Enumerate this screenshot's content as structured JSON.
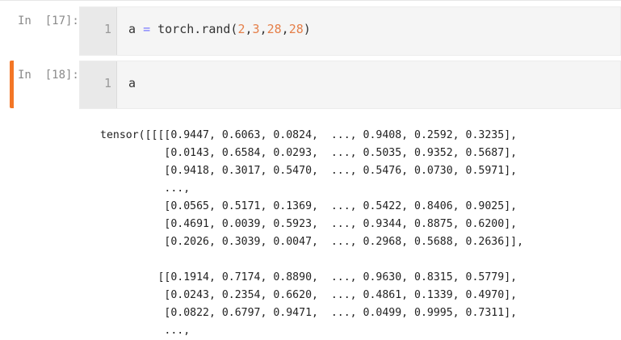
{
  "cells": [
    {
      "prompt": "In  [17]:",
      "line_number": "1",
      "code": {
        "var": "a",
        "op": "=",
        "fn": "torch.rand(",
        "args": [
          "2",
          "3",
          "28",
          "28"
        ],
        "close": ")"
      }
    },
    {
      "prompt": "In  [18]:",
      "line_number": "1",
      "code_text": "a"
    }
  ],
  "output_lines": [
    "tensor([[[[0.9447, 0.6063, 0.0824,  ..., 0.9408, 0.2592, 0.3235],",
    "          [0.0143, 0.6584, 0.0293,  ..., 0.5035, 0.9352, 0.5687],",
    "          [0.9418, 0.3017, 0.5470,  ..., 0.5476, 0.0730, 0.5971],",
    "          ...,",
    "          [0.0565, 0.5171, 0.1369,  ..., 0.5422, 0.8406, 0.9025],",
    "          [0.4691, 0.0039, 0.5923,  ..., 0.9344, 0.8875, 0.6200],",
    "          [0.2026, 0.3039, 0.0047,  ..., 0.2968, 0.5688, 0.2636]],",
    "",
    "         [[0.1914, 0.7174, 0.8890,  ..., 0.9630, 0.8315, 0.5779],",
    "          [0.0243, 0.2354, 0.6620,  ..., 0.4861, 0.1339, 0.4970],",
    "          [0.0822, 0.6797, 0.9471,  ..., 0.0499, 0.9995, 0.7311],",
    "          ...,"
  ],
  "colors": {
    "active_cell_bar": "#f37626",
    "number_literal": "#e57f49",
    "operator": "#7a7aff",
    "prompt_text": "#8a8a8a"
  }
}
